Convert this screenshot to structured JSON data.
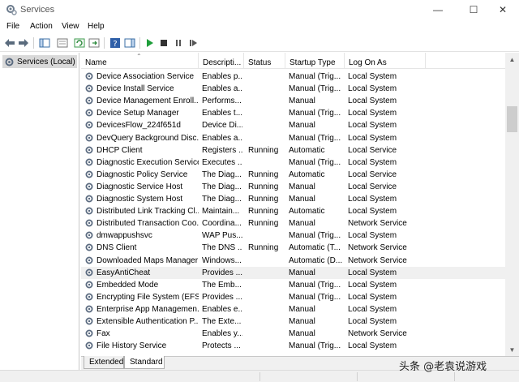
{
  "window": {
    "title": "Services",
    "minimize_glyph": "—",
    "maximize_glyph": "☐",
    "close_glyph": "✕"
  },
  "menu": {
    "file": "File",
    "action": "Action",
    "view": "View",
    "help": "Help"
  },
  "tree": {
    "root_label": "Services (Local)"
  },
  "columns": {
    "name": "Name",
    "description": "Descripti...",
    "status": "Status",
    "startup_type": "Startup Type",
    "log_on_as": "Log On As"
  },
  "services": [
    {
      "name": "Device Association Service",
      "description": "Enables p...",
      "status": "",
      "startup": "Manual (Trig...",
      "logon": "Local System"
    },
    {
      "name": "Device Install Service",
      "description": "Enables a...",
      "status": "",
      "startup": "Manual (Trig...",
      "logon": "Local System"
    },
    {
      "name": "Device Management Enroll...",
      "description": "Performs...",
      "status": "",
      "startup": "Manual",
      "logon": "Local System"
    },
    {
      "name": "Device Setup Manager",
      "description": "Enables t...",
      "status": "",
      "startup": "Manual (Trig...",
      "logon": "Local System"
    },
    {
      "name": "DevicesFlow_224f651d",
      "description": "Device Di...",
      "status": "",
      "startup": "Manual",
      "logon": "Local System"
    },
    {
      "name": "DevQuery Background Disc...",
      "description": "Enables a...",
      "status": "",
      "startup": "Manual (Trig...",
      "logon": "Local System"
    },
    {
      "name": "DHCP Client",
      "description": "Registers ...",
      "status": "Running",
      "startup": "Automatic",
      "logon": "Local Service"
    },
    {
      "name": "Diagnostic Execution Service",
      "description": "Executes ...",
      "status": "",
      "startup": "Manual (Trig...",
      "logon": "Local System"
    },
    {
      "name": "Diagnostic Policy Service",
      "description": "The Diag...",
      "status": "Running",
      "startup": "Automatic",
      "logon": "Local Service"
    },
    {
      "name": "Diagnostic Service Host",
      "description": "The Diag...",
      "status": "Running",
      "startup": "Manual",
      "logon": "Local Service"
    },
    {
      "name": "Diagnostic System Host",
      "description": "The Diag...",
      "status": "Running",
      "startup": "Manual",
      "logon": "Local System"
    },
    {
      "name": "Distributed Link Tracking Cl...",
      "description": "Maintain...",
      "status": "Running",
      "startup": "Automatic",
      "logon": "Local System"
    },
    {
      "name": "Distributed Transaction Coo...",
      "description": "Coordina...",
      "status": "Running",
      "startup": "Manual",
      "logon": "Network Service"
    },
    {
      "name": "dmwappushsvc",
      "description": "WAP Pus...",
      "status": "",
      "startup": "Manual (Trig...",
      "logon": "Local System"
    },
    {
      "name": "DNS Client",
      "description": "The DNS ...",
      "status": "Running",
      "startup": "Automatic (T...",
      "logon": "Network Service"
    },
    {
      "name": "Downloaded Maps Manager",
      "description": "Windows...",
      "status": "",
      "startup": "Automatic (D...",
      "logon": "Network Service"
    },
    {
      "name": "EasyAntiCheat",
      "description": "Provides ...",
      "status": "",
      "startup": "Manual",
      "logon": "Local System"
    },
    {
      "name": "Embedded Mode",
      "description": "The Emb...",
      "status": "",
      "startup": "Manual (Trig...",
      "logon": "Local System"
    },
    {
      "name": "Encrypting File System (EFS)",
      "description": "Provides ...",
      "status": "",
      "startup": "Manual (Trig...",
      "logon": "Local System"
    },
    {
      "name": "Enterprise App Managemen...",
      "description": "Enables e...",
      "status": "",
      "startup": "Manual",
      "logon": "Local System"
    },
    {
      "name": "Extensible Authentication P...",
      "description": "The Exte...",
      "status": "",
      "startup": "Manual",
      "logon": "Local System"
    },
    {
      "name": "Fax",
      "description": "Enables y...",
      "status": "",
      "startup": "Manual",
      "logon": "Network Service"
    },
    {
      "name": "File History Service",
      "description": "Protects ...",
      "status": "",
      "startup": "Manual (Trig...",
      "logon": "Local System"
    }
  ],
  "highlighted_row": 16,
  "tabs": {
    "extended": "Extended",
    "standard": "Standard"
  },
  "watermark": "头条 @老袁说游戏",
  "colors": {
    "play_green": "#1e9e3a",
    "selection_gray": "#d9d9d9",
    "hover_gray": "#f0f0f0"
  }
}
